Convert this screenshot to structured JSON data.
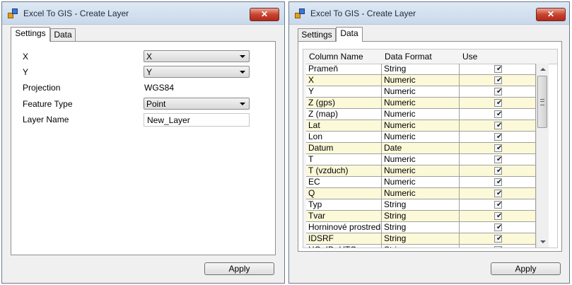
{
  "left_window": {
    "title": "Excel To GIS - Create Layer",
    "close_label": "✕",
    "tabs": [
      {
        "label": "Settings"
      },
      {
        "label": "Data"
      }
    ],
    "form": {
      "x_label": "X",
      "x_value": "X",
      "y_label": "Y",
      "y_value": "Y",
      "projection_label": "Projection",
      "projection_value": "WGS84",
      "feature_type_label": "Feature Type",
      "feature_type_value": "Point",
      "layer_name_label": "Layer Name",
      "layer_name_value": "New_Layer"
    },
    "apply_label": "Apply"
  },
  "right_window": {
    "title": "Excel To GIS - Create Layer",
    "close_label": "✕",
    "tabs": [
      {
        "label": "Settings"
      },
      {
        "label": "Data"
      }
    ],
    "grid": {
      "columns": [
        "Column Name",
        "Data Format",
        "Use"
      ],
      "rows": [
        {
          "name": "Prameň",
          "format": "String",
          "use": true
        },
        {
          "name": "X",
          "format": "Numeric",
          "use": true
        },
        {
          "name": "Y",
          "format": "Numeric",
          "use": true
        },
        {
          "name": "Z (gps)",
          "format": "Numeric",
          "use": true
        },
        {
          "name": "Z (map)",
          "format": "Numeric",
          "use": true
        },
        {
          "name": "Lat",
          "format": "Numeric",
          "use": true
        },
        {
          "name": "Lon",
          "format": "Numeric",
          "use": true
        },
        {
          "name": "Datum",
          "format": "Date",
          "use": true
        },
        {
          "name": "T",
          "format": "Numeric",
          "use": true
        },
        {
          "name": "T (vzduch)",
          "format": "Numeric",
          "use": true
        },
        {
          "name": "EC",
          "format": "Numeric",
          "use": true
        },
        {
          "name": "Q",
          "format": "Numeric",
          "use": true
        },
        {
          "name": "Typ",
          "format": "String",
          "use": true
        },
        {
          "name": "Tvar",
          "format": "String",
          "use": true
        },
        {
          "name": "Horninové prostredie",
          "format": "String",
          "use": true
        },
        {
          "name": "IDSRF",
          "format": "String",
          "use": true
        },
        {
          "name": "HG_ID_UTO",
          "format": "String",
          "use": true
        }
      ],
      "check_mark": "✔"
    },
    "apply_label": "Apply"
  }
}
